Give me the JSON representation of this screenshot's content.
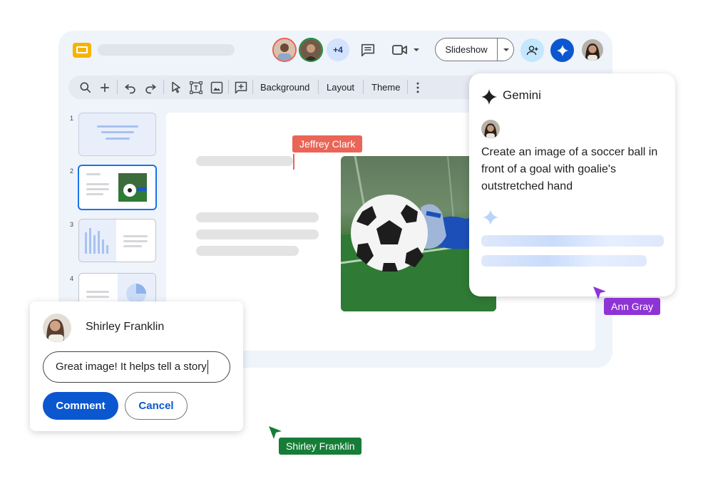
{
  "app": {
    "toolbar": {
      "background_label": "Background",
      "layout_label": "Layout",
      "theme_label": "Theme"
    },
    "header": {
      "more_collaborators": "+4",
      "slideshow_label": "Slideshow"
    },
    "slides": [
      {
        "number": "1"
      },
      {
        "number": "2"
      },
      {
        "number": "3"
      },
      {
        "number": "4"
      }
    ]
  },
  "cursors": {
    "jeffrey": {
      "name": "Jeffrey Clark",
      "color": "#ea6557"
    },
    "ann": {
      "name": "Ann Gray",
      "color": "#8e34d4"
    },
    "shirley": {
      "name": "Shirley Franklin",
      "color": "#167d38"
    }
  },
  "gemini": {
    "title": "Gemini",
    "prompt": "Create an image of a soccer ball in front of a goal with goalie's outstretched hand"
  },
  "comment": {
    "author": "Shirley Franklin",
    "input_value": "Great image! It helps tell a story",
    "comment_button": "Comment",
    "cancel_button": "Cancel"
  },
  "colors": {
    "accent": "#0b57d0",
    "window_bg": "#eff3fa",
    "logo_yellow": "#f6b400"
  },
  "icons": [
    "slides-logo-icon",
    "search-icon",
    "plus-icon",
    "undo-icon",
    "redo-icon",
    "select-cursor-icon",
    "textbox-icon",
    "image-icon",
    "comment-add-icon",
    "more-vert-icon",
    "comment-icon",
    "video-call-icon",
    "share-person-icon",
    "gemini-sparkle-icon"
  ]
}
